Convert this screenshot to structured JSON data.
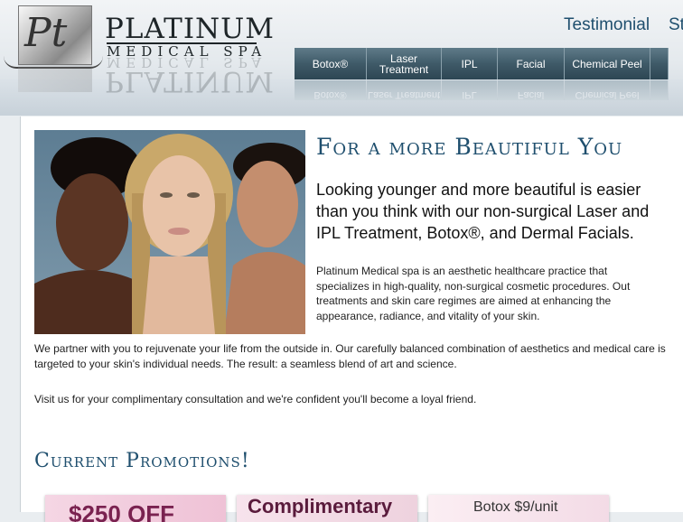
{
  "brand": {
    "monogram": "Pt",
    "title": "PLATINUM",
    "subtitle": "MEDICAL SPA"
  },
  "top_links": [
    "Testimonial",
    "St"
  ],
  "nav": [
    {
      "label": "Botox®",
      "width": 80
    },
    {
      "label": "Laser Treatment",
      "width": 83
    },
    {
      "label": "IPL",
      "width": 62
    },
    {
      "label": "Facial",
      "width": 74
    },
    {
      "label": "Chemical Peel",
      "width": 95
    },
    {
      "label": "",
      "width": 20
    }
  ],
  "main": {
    "headline": "For a more Beautiful You",
    "lead": "Looking younger and more beautiful is easier than you think with our non-surgical Laser and IPL Treatment, Botox®, and Dermal Facials.",
    "intro": "Platinum Medical spa is an aesthetic healthcare practice that specializes in high-quality, non-surgical cosmetic procedures. Out treatments and skin care regimes are aimed at enhancing the appearance, radiance, and vitality of your skin.",
    "paragraph_1": "We partner with you to rejuvenate your life from the outside in. Our carefully balanced combination of aesthetics and medical care is targeted to your skin's individual needs. The result: a seamless blend of art and science.",
    "paragraph_2": "Visit us for your complimentary consultation and we're confident you'll become a loyal friend."
  },
  "promotions": {
    "heading": "Current Promotions!",
    "cards": [
      {
        "text": "$250 OFF",
        "color": "#7a2250"
      },
      {
        "text": "Complimentary",
        "color": "#5a1b3c"
      },
      {
        "text": "Botox $9/unit",
        "color": "#333333"
      }
    ]
  },
  "colors": {
    "accent": "#1f4f6e",
    "nav_bg": "#3f5a68",
    "promo_pink": "#f4dce6"
  }
}
